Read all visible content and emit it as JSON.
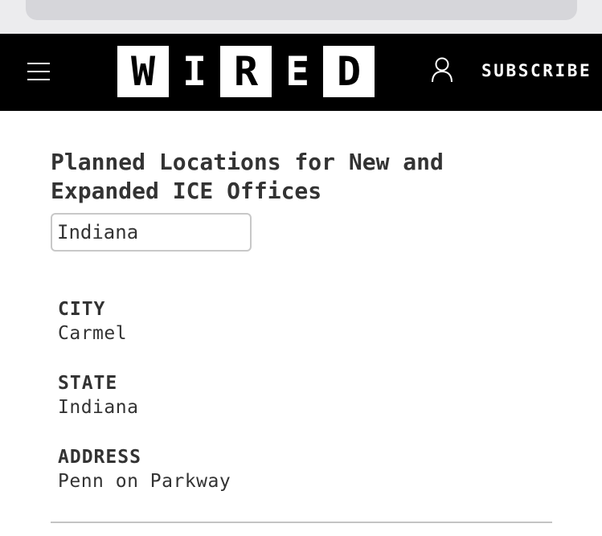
{
  "header": {
    "logo_letters": [
      "W",
      "I",
      "R",
      "E",
      "D"
    ],
    "subscribe_label": "SUBSCRIBE",
    "menu_icon": "hamburger-menu-icon",
    "account_icon": "user-account-icon"
  },
  "main": {
    "table_title": "Planned Locations for New and Expanded ICE Offices",
    "filter": {
      "value": "Indiana",
      "placeholder": ""
    },
    "record": {
      "city_label": "CITY",
      "city_value": "Carmel",
      "state_label": "STATE",
      "state_value": "Indiana",
      "address_label": "ADDRESS",
      "address_value": "Penn on Parkway"
    }
  },
  "colors": {
    "header_bg": "#000000",
    "text": "#333333",
    "browser_chrome": "#ececee"
  }
}
